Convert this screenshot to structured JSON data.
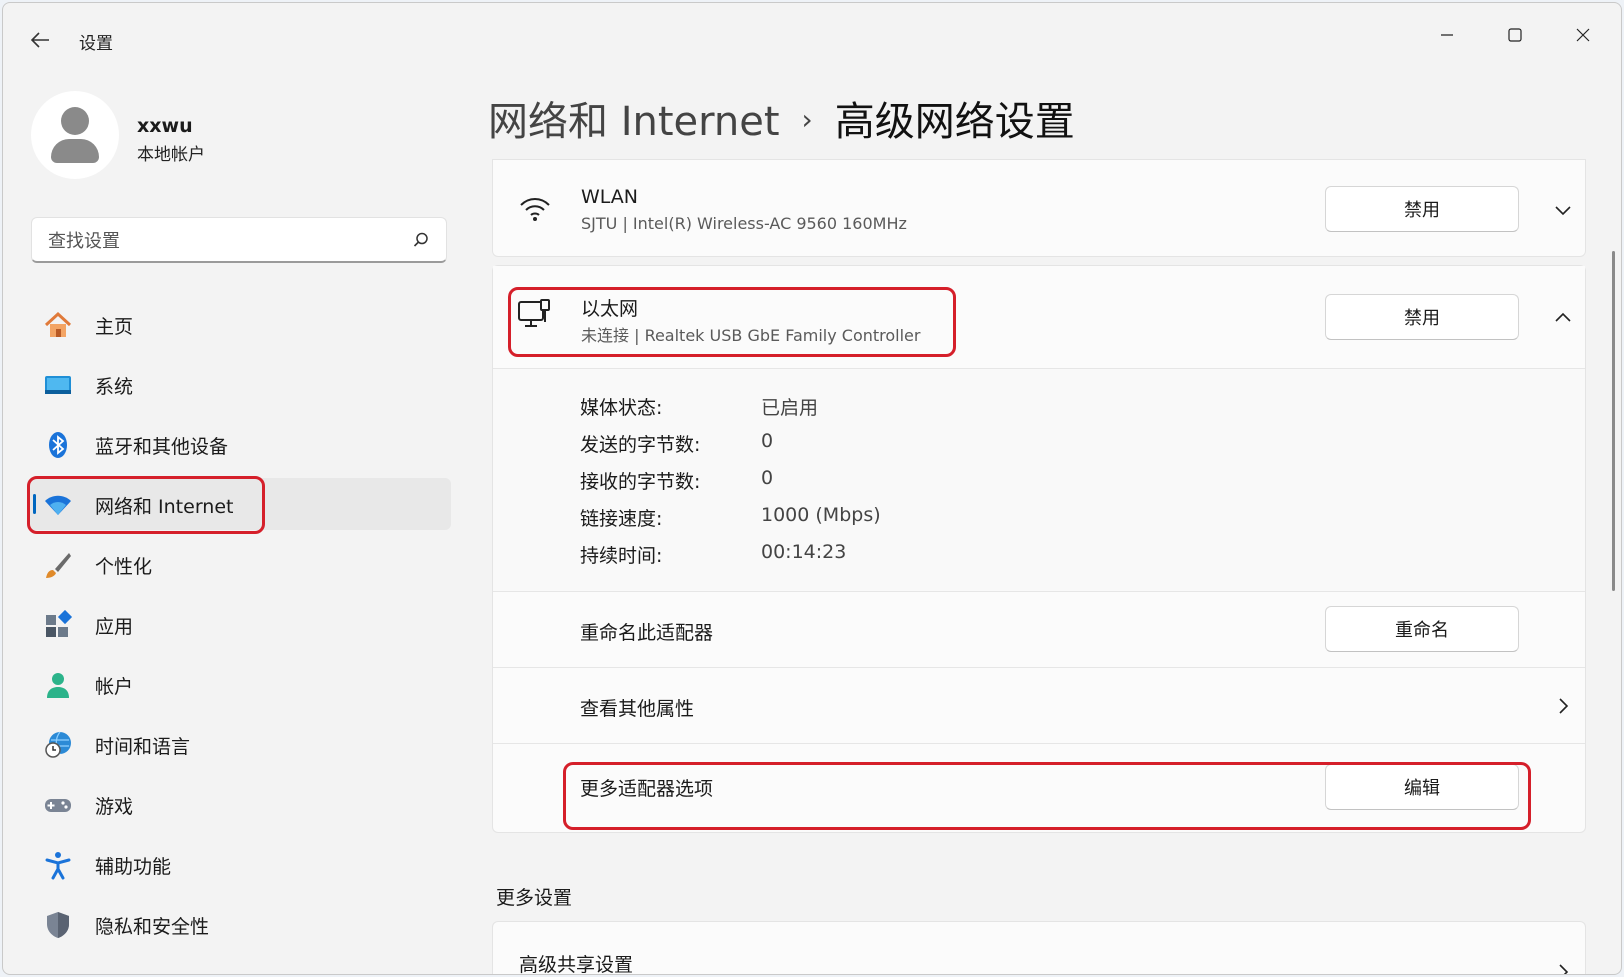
{
  "window": {
    "title": "设置"
  },
  "profile": {
    "name": "xxwu",
    "account_type": "本地帐户"
  },
  "search": {
    "placeholder": "查找设置"
  },
  "sidebar": {
    "items": [
      {
        "label": "主页",
        "icon": "home-icon"
      },
      {
        "label": "系统",
        "icon": "display-icon"
      },
      {
        "label": "蓝牙和其他设备",
        "icon": "bluetooth-icon"
      },
      {
        "label": "网络和 Internet",
        "icon": "wifi-icon",
        "active": true
      },
      {
        "label": "个性化",
        "icon": "brush-icon"
      },
      {
        "label": "应用",
        "icon": "apps-icon"
      },
      {
        "label": "帐户",
        "icon": "person-icon"
      },
      {
        "label": "时间和语言",
        "icon": "globe-clock-icon"
      },
      {
        "label": "游戏",
        "icon": "gamepad-icon"
      },
      {
        "label": "辅助功能",
        "icon": "accessibility-icon"
      },
      {
        "label": "隐私和安全性",
        "icon": "shield-icon"
      }
    ]
  },
  "breadcrumb": {
    "parent": "网络和 Internet",
    "separator": "›",
    "current": "高级网络设置"
  },
  "adapters": {
    "wlan": {
      "name": "WLAN",
      "detail": "SJTU | Intel(R) Wireless-AC 9560 160MHz",
      "button": "禁用"
    },
    "ethernet": {
      "name": "以太网",
      "detail": "未连接 | Realtek USB GbE Family Controller",
      "button": "禁用",
      "properties": [
        {
          "label": "媒体状态:",
          "value": "已启用"
        },
        {
          "label": "发送的字节数:",
          "value": "0"
        },
        {
          "label": "接收的字节数:",
          "value": "0"
        },
        {
          "label": "链接速度:",
          "value": "1000 (Mbps)"
        },
        {
          "label": "持续时间:",
          "value": "00:14:23"
        }
      ],
      "rename": {
        "label": "重命名此适配器",
        "button": "重命名"
      },
      "more_props": {
        "label": "查看其他属性"
      },
      "more_options": {
        "label": "更多适配器选项",
        "button": "编辑"
      }
    }
  },
  "more_settings": {
    "title": "更多设置",
    "items": [
      {
        "label": "高级共享设置"
      }
    ]
  },
  "colors": {
    "accent": "#0067c0",
    "highlight": "#d51f2a"
  }
}
